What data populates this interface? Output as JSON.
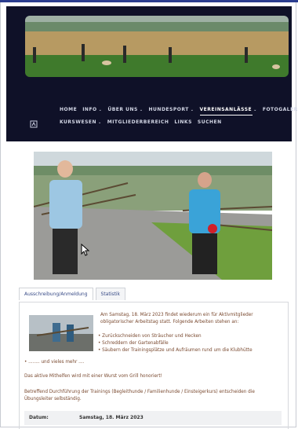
{
  "nav": {
    "row1": [
      {
        "label": "HOME",
        "dropdown": false,
        "active": false
      },
      {
        "label": "INFO",
        "dropdown": true,
        "active": false
      },
      {
        "label": "ÜBER UNS",
        "dropdown": true,
        "active": false
      },
      {
        "label": "HUNDESPORT",
        "dropdown": true,
        "active": false
      },
      {
        "label": "VEREINSANLÄSSE",
        "dropdown": true,
        "active": true
      },
      {
        "label": "FOTOGALERIE",
        "dropdown": true,
        "active": false
      }
    ],
    "row2": [
      {
        "label": "KURSWESEN",
        "dropdown": true,
        "active": false
      },
      {
        "label": "MITGLIEDERBEREICH",
        "dropdown": false,
        "active": false
      },
      {
        "label": "LINKS",
        "dropdown": false,
        "active": false
      },
      {
        "label": "SUCHEN",
        "dropdown": false,
        "active": false
      }
    ]
  },
  "tabs": [
    {
      "label": "Ausschreibung/Anmeldung",
      "active": true
    },
    {
      "label": "Statistik",
      "active": false
    }
  ],
  "content": {
    "intro": "Am Samstag, 18. März 2023 findet wiederum ein für Aktivmitglieder obligatorischer Arbeitstag statt. Folgende Arbeiten stehen an:",
    "bullets": [
      "Zurückschneiden von Sträucher und Hecken",
      "Schreddern der Gartenabfälle",
      "Säubern der Trainingsplätze und Aufräumen rund um die Klubhütte"
    ],
    "etc": "........ und vieles mehr ....",
    "grill": "Das aktive Mithelfen wird mit einer Wurst vom Grill honoriert!",
    "training": "Betreffend Durchführung der Trainings (Begleithunde / Familienhunde / Einsteigerkurs) entscheiden die Übungsleiter selbständig.",
    "date_label": "Datum:",
    "date_value": "Samstag, 18. März 2023"
  },
  "colors": {
    "header_bg": "#0f1128",
    "nav_text": "#d3d7e6",
    "body_text": "#7a4a30",
    "tab_text": "#374a86"
  }
}
